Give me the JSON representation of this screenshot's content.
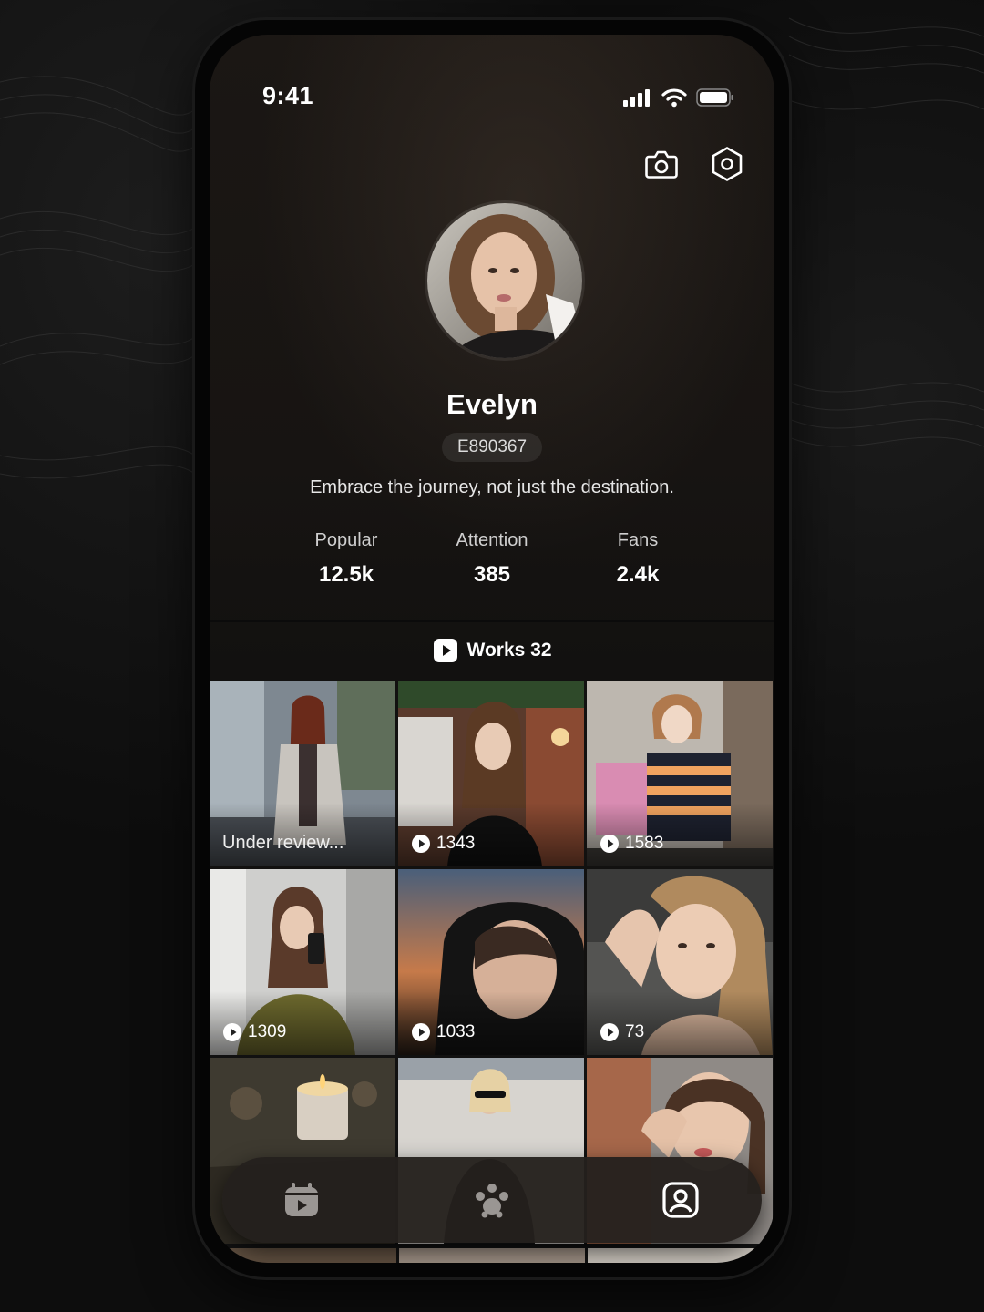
{
  "status_bar": {
    "time": "9:41",
    "icons": [
      "signal-icon",
      "wifi-icon",
      "battery-icon"
    ]
  },
  "header_actions": {
    "icons": [
      "camera-icon",
      "settings-icon"
    ]
  },
  "profile": {
    "name": "Evelyn",
    "id": "E890367",
    "bio": "Embrace the journey, not just the destination."
  },
  "stats": [
    {
      "label": "Popular",
      "value": "12.5k"
    },
    {
      "label": "Attention",
      "value": "385"
    },
    {
      "label": "Fans",
      "value": "2.4k"
    }
  ],
  "works": {
    "label": "Works 32",
    "icon": "play-square-icon"
  },
  "grid": [
    {
      "status": "Under review..."
    },
    {
      "count": "1343"
    },
    {
      "count": "1583"
    },
    {
      "count": "1309"
    },
    {
      "count": "1033"
    },
    {
      "count": "73"
    },
    {},
    {},
    {}
  ],
  "tabbar": {
    "items": [
      "video-calendar-icon",
      "community-icon",
      "profile-icon"
    ],
    "active": "profile-icon"
  },
  "colors": {
    "background": "#0d0d0d",
    "screen": "#171412",
    "text_primary": "#ffffff",
    "tabbar": "#24201d"
  }
}
